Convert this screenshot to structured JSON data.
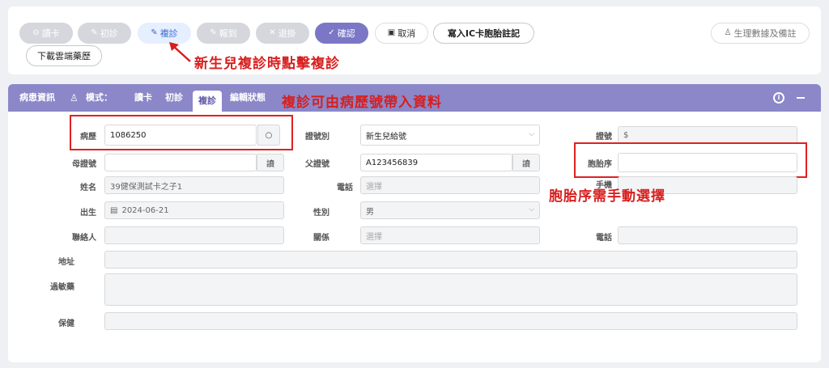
{
  "toolbar": {
    "read_card": "讀卡",
    "first_visit": "初診",
    "revisit": "複診",
    "register": "報到",
    "withdraw": "退掛",
    "confirm": "確認",
    "cancel": "取消",
    "write_ic": "寫入IC卡胞胎註記",
    "physio": "生理數據及備註",
    "download_cloud": "下載雲端藥歷"
  },
  "annotations": {
    "revisit_tip": "新生兒複診時點擊複診",
    "record_tip": "複診可由病歷號帶入資料",
    "birth_order_tip": "胞胎序需手動選擇"
  },
  "panel": {
    "title": "病患資訊",
    "mode_label": "模式：",
    "modes": [
      "讀卡",
      "初診",
      "複診",
      "編輯狀態"
    ],
    "selected_mode": "複診"
  },
  "form": {
    "record_label": "病歷",
    "record_value": "1086250",
    "id_type_label": "證號別",
    "id_type_value": "新生兒給號",
    "id_label": "證號",
    "id_value": "$",
    "mother_id_label": "母證號",
    "mother_id_value": "",
    "read_btn": "讀",
    "father_id_label": "父證號",
    "father_id_value": "A123456839",
    "birth_order_label": "胞胎序",
    "birth_order_value": "",
    "name_label": "姓名",
    "name_value": "39健保測試卡之子1",
    "phone_label": "電話",
    "select_placeholder": "選擇",
    "mobile_label": "手機",
    "birth_label": "出生",
    "birth_value": "2024-06-21",
    "gender_label": "性別",
    "gender_value": "男",
    "contact_label": "聯絡人",
    "relation_label": "關係",
    "phone2_label": "電話",
    "address_label": "地址",
    "allergy_label": "過敏藥",
    "insurance_label": "保健"
  },
  "colors": {
    "accent": "#8b87c8",
    "primary_btn": "#7b77c6",
    "annotation_red": "#d81e1e"
  }
}
